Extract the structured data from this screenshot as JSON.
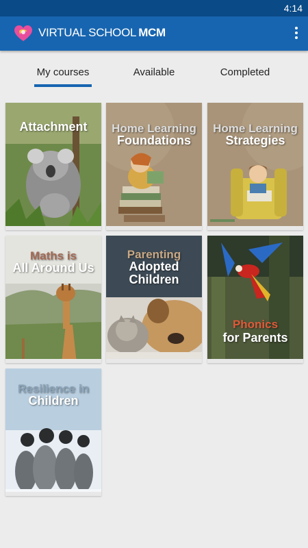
{
  "status_bar": {
    "time": "4:14"
  },
  "app_bar": {
    "title_prefix": "VIRTUAL SCHOOL",
    "title_suffix": "MCM",
    "menu_icon": "more-vert-icon"
  },
  "tabs": [
    {
      "label": "My courses",
      "selected": true
    },
    {
      "label": "Available",
      "selected": false
    },
    {
      "label": "Completed",
      "selected": false
    }
  ],
  "colors": {
    "status_bar": "#0a4a86",
    "app_bar": "#1765b0",
    "accent": "#1765b0",
    "background": "#ececec"
  },
  "courses": [
    {
      "line1": "",
      "line2": "Attachment"
    },
    {
      "line1": "Home Learning",
      "line2": "Foundations"
    },
    {
      "line1": "Home Learning",
      "line2": "Strategies"
    },
    {
      "line1": "Maths is",
      "line2": "All Around Us"
    },
    {
      "line1": "Parenting",
      "line2": "Adopted Children"
    },
    {
      "line1": "Phonics",
      "line2": "for Parents"
    },
    {
      "line1": "Resilience in",
      "line2": "Children"
    }
  ]
}
